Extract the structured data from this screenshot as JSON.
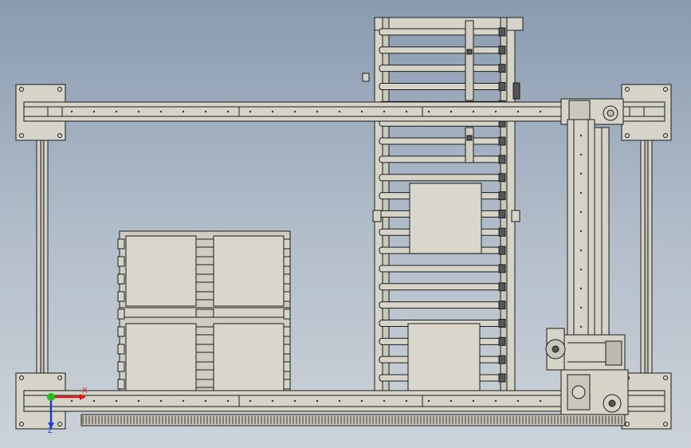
{
  "view_triad": {
    "x_label": "X",
    "z_label": "Z",
    "x_color": "#e01818",
    "y_color": "#1fbf1f",
    "z_color": "#1c3cd8"
  },
  "colors": {
    "background_top": "#8a9bb0",
    "background_bottom": "#ccd2d8",
    "part_fill": "#d6d4c8",
    "box_fill": "#d9d7cc",
    "edge": "#1c1c1c"
  },
  "assembly": {
    "gantry_columns": 4,
    "conveyor_rollers": 20,
    "cartons_on_pallet": 4,
    "cartons_on_conveyor": 2
  }
}
